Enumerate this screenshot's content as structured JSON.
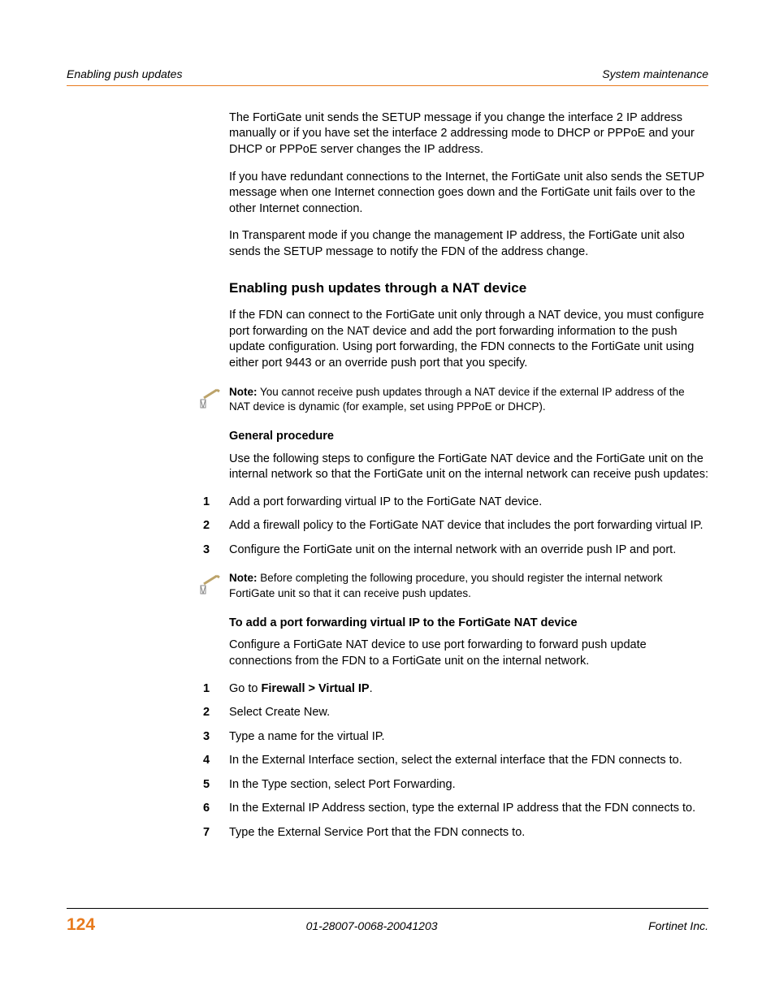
{
  "header": {
    "left": "Enabling push updates",
    "right": "System maintenance"
  },
  "intro": {
    "p1": "The FortiGate unit sends the SETUP message if you change the interface 2 IP address manually or if you have set the interface 2 addressing mode to DHCP or PPPoE and your DHCP or PPPoE server changes the IP address.",
    "p2": "If you have redundant connections to the Internet, the FortiGate unit also sends the SETUP message when one Internet connection goes down and the FortiGate unit fails over to the other Internet connection.",
    "p3": "In Transparent mode if you change the management IP address, the FortiGate unit also sends the SETUP message to notify the FDN of the address change."
  },
  "section": {
    "title": "Enabling push updates through a NAT device",
    "p": "If the FDN can connect to the FortiGate unit only through a NAT device, you must configure port forwarding on the NAT device and add the port forwarding information to the push update configuration. Using port forwarding, the FDN connects to the FortiGate unit using either port 9443 or an override push port that you specify."
  },
  "note1": {
    "label": "Note:",
    "text": " You cannot receive push updates through a NAT device if the external IP address of the NAT device is dynamic (for example, set using PPPoE or DHCP)."
  },
  "general": {
    "heading": "General procedure",
    "intro": "Use the following steps to configure the FortiGate NAT device and the FortiGate unit on the internal network so that the FortiGate unit on the internal network can receive push updates:",
    "steps": [
      "Add a port forwarding virtual IP to the FortiGate NAT device.",
      "Add a firewall policy to the FortiGate NAT device that includes the port forwarding virtual IP.",
      "Configure the FortiGate unit on the internal network with an override push IP and port."
    ]
  },
  "note2": {
    "label": "Note:",
    "text": " Before completing the following procedure, you should register the internal network FortiGate unit so that it can receive push updates."
  },
  "proc": {
    "heading": "To add a port forwarding virtual IP to the FortiGate NAT device",
    "intro": "Configure a FortiGate NAT device to use port forwarding to forward push update connections from the FDN to a FortiGate unit on the internal network.",
    "steps": {
      "s1a": "Go to ",
      "s1b": "Firewall > Virtual IP",
      "s1c": ".",
      "s2": "Select Create New.",
      "s3": "Type a name for the virtual IP.",
      "s4": "In the External Interface section, select the external interface that the FDN connects to.",
      "s5": "In the Type section, select Port Forwarding.",
      "s6": "In the External IP Address section, type the external IP address that the FDN connects to.",
      "s7": "Type the External Service Port that the FDN connects to."
    }
  },
  "footer": {
    "page": "124",
    "docid": "01-28007-0068-20041203",
    "company": "Fortinet Inc."
  }
}
